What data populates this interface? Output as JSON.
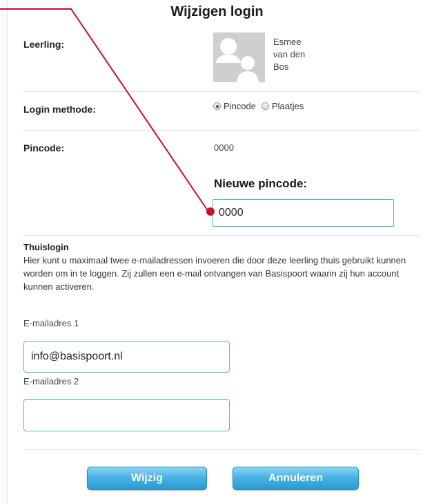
{
  "dialog": {
    "title": "Wijzigen login"
  },
  "student": {
    "label": "Leerling:",
    "name_lines": [
      "Esmee",
      "van den",
      "Bos"
    ]
  },
  "login_method": {
    "label": "Login methode:",
    "options": [
      {
        "label": "Pincode",
        "checked": true
      },
      {
        "label": "Plaatjes",
        "checked": false
      }
    ]
  },
  "pincode": {
    "label": "Pincode:",
    "value": "0000",
    "new_heading": "Nieuwe pincode:",
    "new_value": "0000"
  },
  "home_login": {
    "heading": "Thuislogin",
    "description": "Hier kunt u maximaal twee e-mailadressen invoeren die door deze leerling thuis gebruikt kunnen worden om in te loggen. Zij zullen een e-mail ontvangen van Basispoort waarin zij hun account kunnen activeren.",
    "email1_label": "E-mailadres 1",
    "email1_value": "info@basispoort.nl",
    "email2_label": "E-mailadres 2",
    "email2_value": ""
  },
  "buttons": {
    "save": "Wijzig",
    "cancel": "Annuleren"
  },
  "colors": {
    "accent": "#49b3e3",
    "input_border": "#4db8d6",
    "annotation": "#c8102e"
  }
}
